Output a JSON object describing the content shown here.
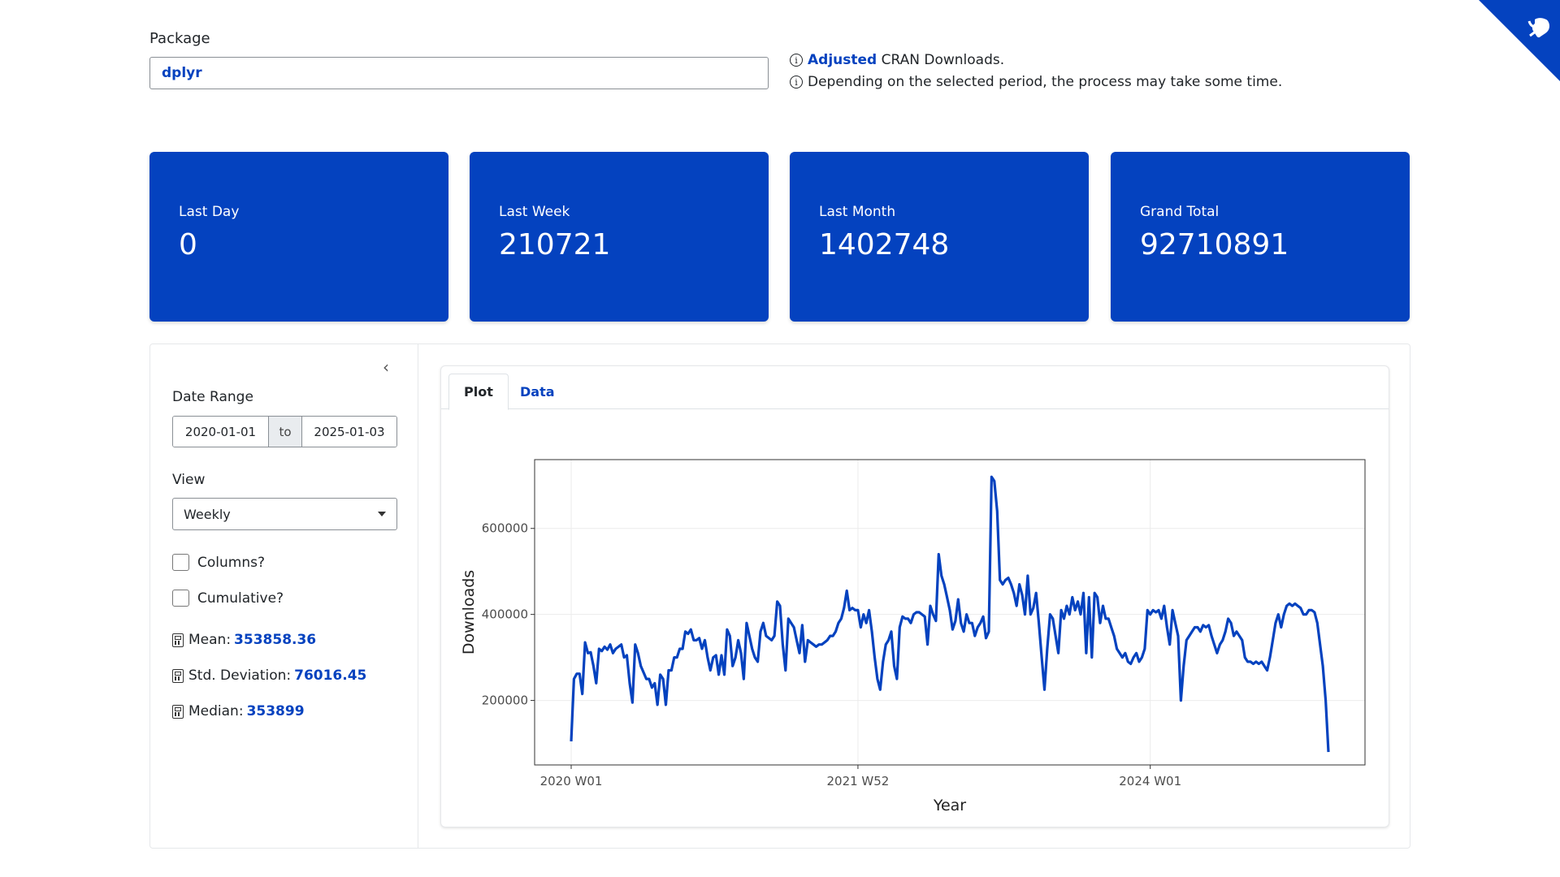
{
  "package": {
    "label": "Package",
    "value": "dplyr"
  },
  "info": {
    "line1_link": "Adjusted",
    "line1_rest": "CRAN Downloads.",
    "line2": "Depending on the selected period, the process may take some time."
  },
  "value_boxes": [
    {
      "title": "Last Day",
      "value": "0"
    },
    {
      "title": "Last Week",
      "value": "210721"
    },
    {
      "title": "Last Month",
      "value": "1402748"
    },
    {
      "title": "Grand Total",
      "value": "92710891"
    }
  ],
  "sidebar": {
    "date_range_label": "Date Range",
    "date_start": "2020-01-01",
    "date_sep": "to",
    "date_end": "2025-01-03",
    "view_label": "View",
    "view_value": "Weekly",
    "columns_label": "Columns?",
    "cumulative_label": "Cumulative?",
    "mean_label": "Mean:",
    "mean_value": "353858.36",
    "sd_label": "Std. Deviation:",
    "sd_value": "76016.45",
    "median_label": "Median:",
    "median_value": "353899"
  },
  "tabs": {
    "plot": "Plot",
    "data": "Data"
  },
  "colors": {
    "accent": "#0442bf",
    "line": "#0442bf"
  },
  "icons": {
    "github": "github-corner-icon",
    "info": "info-circle-icon",
    "calculator": "calculator-icon",
    "collapse": "chevron-left-icon"
  },
  "chart_data": {
    "type": "line",
    "xlabel": "Year",
    "ylabel": "Downloads",
    "x_ticks": [
      {
        "label": "2020 W01",
        "index": 0
      },
      {
        "label": "2021 W52",
        "index": 103
      },
      {
        "label": "2024 W01",
        "index": 208
      }
    ],
    "y_ticks": [
      200000,
      400000,
      600000
    ],
    "ylim": [
      50000,
      760000
    ],
    "grid": true,
    "series": [
      {
        "values": [
          105000,
          250000,
          262000,
          262000,
          215000,
          335000,
          310000,
          312000,
          280000,
          240000,
          320000,
          315000,
          325000,
          318000,
          330000,
          310000,
          320000,
          325000,
          330000,
          300000,
          305000,
          240000,
          195000,
          330000,
          310000,
          280000,
          265000,
          250000,
          250000,
          230000,
          240000,
          190000,
          260000,
          250000,
          190000,
          270000,
          270000,
          300000,
          300000,
          320000,
          320000,
          360000,
          355000,
          365000,
          340000,
          340000,
          345000,
          320000,
          340000,
          300000,
          270000,
          300000,
          305000,
          260000,
          305000,
          260000,
          365000,
          350000,
          280000,
          300000,
          340000,
          310000,
          250000,
          380000,
          350000,
          320000,
          300000,
          290000,
          360000,
          380000,
          350000,
          345000,
          340000,
          350000,
          430000,
          420000,
          330000,
          270000,
          390000,
          380000,
          370000,
          340000,
          310000,
          375000,
          290000,
          340000,
          335000,
          330000,
          325000,
          330000,
          330000,
          335000,
          340000,
          350000,
          350000,
          360000,
          380000,
          390000,
          415000,
          455000,
          410000,
          415000,
          410000,
          410000,
          370000,
          400000,
          380000,
          410000,
          360000,
          300000,
          250000,
          225000,
          290000,
          330000,
          340000,
          360000,
          280000,
          250000,
          370000,
          395000,
          390000,
          390000,
          380000,
          400000,
          405000,
          405000,
          400000,
          395000,
          330000,
          420000,
          400000,
          385000,
          540000,
          490000,
          470000,
          440000,
          410000,
          365000,
          385000,
          435000,
          380000,
          360000,
          400000,
          380000,
          380000,
          350000,
          370000,
          380000,
          395000,
          345000,
          360000,
          720000,
          710000,
          640000,
          480000,
          470000,
          480000,
          485000,
          470000,
          450000,
          420000,
          470000,
          445000,
          400000,
          490000,
          400000,
          415000,
          450000,
          380000,
          300000,
          225000,
          320000,
          400000,
          390000,
          350000,
          310000,
          410000,
          390000,
          420000,
          400000,
          440000,
          410000,
          430000,
          400000,
          450000,
          310000,
          440000,
          300000,
          450000,
          440000,
          380000,
          420000,
          390000,
          390000,
          370000,
          350000,
          320000,
          310000,
          300000,
          310000,
          290000,
          285000,
          300000,
          310000,
          290000,
          300000,
          320000,
          410000,
          400000,
          410000,
          405000,
          410000,
          390000,
          420000,
          370000,
          330000,
          410000,
          380000,
          350000,
          200000,
          280000,
          340000,
          350000,
          360000,
          370000,
          370000,
          360000,
          375000,
          370000,
          375000,
          350000,
          330000,
          310000,
          330000,
          340000,
          360000,
          390000,
          380000,
          350000,
          360000,
          350000,
          340000,
          300000,
          290000,
          290000,
          285000,
          290000,
          285000,
          290000,
          280000,
          270000,
          300000,
          340000,
          380000,
          400000,
          370000,
          400000,
          420000,
          425000,
          420000,
          425000,
          420000,
          415000,
          400000,
          400000,
          410000,
          410000,
          405000,
          380000,
          330000,
          280000,
          200000,
          80000
        ]
      }
    ]
  }
}
